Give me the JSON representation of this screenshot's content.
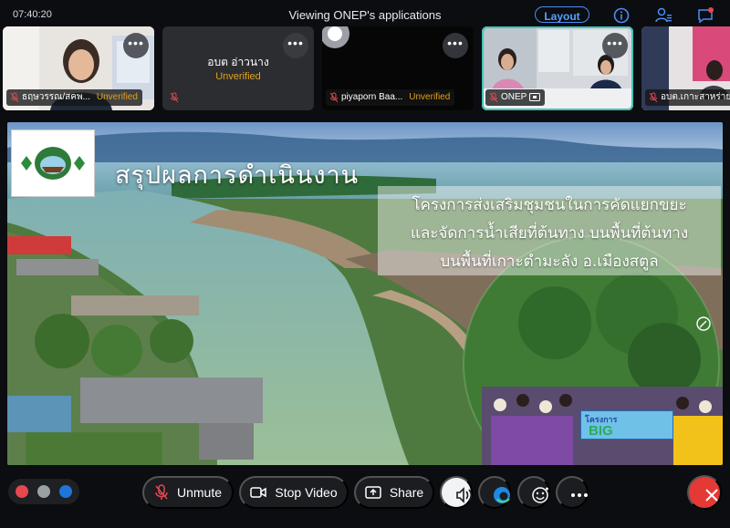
{
  "window": {
    "time": "07:40:20",
    "title": "Viewing ONEP's applications",
    "layout_label": "Layout"
  },
  "participants": [
    {
      "name": "ธฤษวรรณ/สคพ...",
      "status": "Unverified",
      "muted": true,
      "video": true
    },
    {
      "name": "อบต อ่าวนาง",
      "status": "Unverified",
      "muted": true,
      "video": false
    },
    {
      "name": "piyaporn Baa...",
      "status": "Unverified",
      "muted": true,
      "video": true
    },
    {
      "name": "ONEP",
      "status": "",
      "muted": true,
      "video": true,
      "active": true
    },
    {
      "name": "อบต.เกาะสาหร่าย",
      "status": "",
      "muted": true,
      "video": true
    }
  ],
  "menu_glyph": "•••",
  "share": {
    "title": "สรุปผลการดำเนินงาน",
    "project_lines": [
      "โครงการส่งเสริมชุมชนในการคัดแยกขยะ",
      "และจัดการน้ำเสียที่ต้นทาง บนพื้นที่ต้นทาง",
      "บนพื้นที่เกาะตำมะลัง อ.เมืองสตูล"
    ],
    "logo_top": "อบต.ตำมะลัง",
    "logo_bottom": "อ.เมือง จ.สตูล",
    "banner_text": "BIG",
    "banner_sub": "โครงการ"
  },
  "toolbar": {
    "unmute_label": "Unmute",
    "stop_video_label": "Stop Video",
    "share_label": "Share"
  },
  "colors": {
    "accent": "#4a8df8",
    "unverified": "#e0a21b",
    "active_outline": "#44c3b9",
    "end": "#e53935",
    "mute_red": "#e5484d"
  }
}
